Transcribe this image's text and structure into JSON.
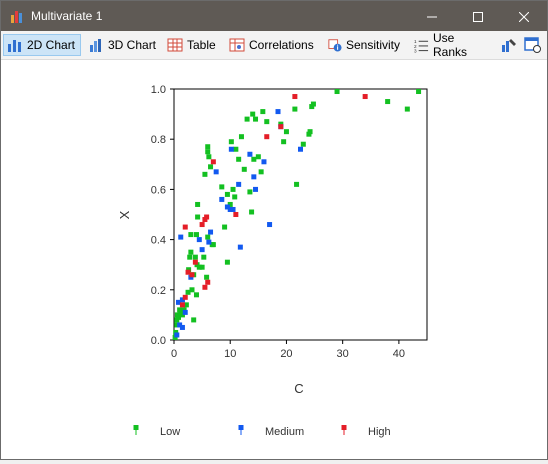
{
  "window": {
    "title": "Multivariate 1"
  },
  "toolbar": {
    "tabs": [
      {
        "label": "2D Chart",
        "icon": "bar-chart-icon",
        "active": true
      },
      {
        "label": "3D Chart",
        "icon": "3d-chart-icon",
        "active": false
      },
      {
        "label": "Table",
        "icon": "table-icon",
        "active": false
      },
      {
        "label": "Correlations",
        "icon": "correlations-icon",
        "active": false
      },
      {
        "label": "Sensitivity",
        "icon": "sensitivity-icon",
        "active": false
      },
      {
        "label": "Use Ranks",
        "icon": "ranks-icon",
        "active": false
      }
    ],
    "icons": [
      "chart-settings-icon",
      "window-options-icon"
    ]
  },
  "colors": {
    "Low": "#13c021",
    "Medium": "#1259f0",
    "High": "#e41e28"
  },
  "chart_data": {
    "type": "scatter",
    "xlabel": "C",
    "ylabel": "X",
    "xlim": [
      0,
      45
    ],
    "ylim": [
      0,
      1
    ],
    "xticks": [
      "0",
      "10",
      "20",
      "30",
      "40"
    ],
    "yticks": [
      "0.0",
      "0.2",
      "0.4",
      "0.6",
      "0.8",
      "1.0"
    ],
    "grid": false,
    "legend_position": "bottom",
    "series": [
      {
        "name": "Low",
        "points": [
          [
            0.2,
            0.01
          ],
          [
            0.3,
            0.03
          ],
          [
            0.5,
            0.06
          ],
          [
            0.5,
            0.08
          ],
          [
            0.6,
            0.1
          ],
          [
            0.8,
            0.09
          ],
          [
            1,
            0.12
          ],
          [
            1.2,
            0.11
          ],
          [
            1.5,
            0.1
          ],
          [
            1.8,
            0.12
          ],
          [
            2.2,
            0.14
          ],
          [
            2.5,
            0.19
          ],
          [
            2.6,
            0.28
          ],
          [
            2.8,
            0.33
          ],
          [
            3,
            0.35
          ],
          [
            3,
            0.42
          ],
          [
            3.2,
            0.2
          ],
          [
            3.5,
            0.26
          ],
          [
            3.5,
            0.08
          ],
          [
            3.8,
            0.33
          ],
          [
            4,
            0.42
          ],
          [
            4,
            0.18
          ],
          [
            4.1,
            0.3
          ],
          [
            4.2,
            0.49
          ],
          [
            4.2,
            0.54
          ],
          [
            4.5,
            0.29
          ],
          [
            5,
            0.29
          ],
          [
            5.3,
            0.33
          ],
          [
            5.5,
            0.66
          ],
          [
            5.8,
            0.25
          ],
          [
            6,
            0.75
          ],
          [
            6,
            0.77
          ],
          [
            6,
            0.41
          ],
          [
            6.2,
            0.73
          ],
          [
            6.5,
            0.69
          ],
          [
            6.8,
            0.38
          ],
          [
            7,
            0.38
          ],
          [
            8.5,
            0.61
          ],
          [
            9,
            0.45
          ],
          [
            9.5,
            0.58
          ],
          [
            9.5,
            0.31
          ],
          [
            10,
            0.54
          ],
          [
            10.2,
            0.79
          ],
          [
            10.5,
            0.6
          ],
          [
            10.8,
            0.57
          ],
          [
            11,
            0.76
          ],
          [
            11.5,
            0.72
          ],
          [
            12,
            0.81
          ],
          [
            12.5,
            0.68
          ],
          [
            13,
            0.88
          ],
          [
            13.5,
            0.59
          ],
          [
            13.8,
            0.51
          ],
          [
            14,
            0.9
          ],
          [
            14.2,
            0.72
          ],
          [
            14.5,
            0.88
          ],
          [
            15,
            0.73
          ],
          [
            15.5,
            0.67
          ],
          [
            15.8,
            0.91
          ],
          [
            16.5,
            0.87
          ],
          [
            19,
            0.86
          ],
          [
            19.5,
            0.79
          ],
          [
            20,
            0.83
          ],
          [
            21.5,
            0.92
          ],
          [
            21.8,
            0.62
          ],
          [
            23,
            0.78
          ],
          [
            24,
            0.82
          ],
          [
            24.2,
            0.83
          ],
          [
            24.5,
            0.93
          ],
          [
            24.8,
            0.94
          ],
          [
            29,
            0.99
          ],
          [
            38,
            0.95
          ],
          [
            41.5,
            0.92
          ],
          [
            43.5,
            0.99
          ]
        ]
      },
      {
        "name": "Medium",
        "points": [
          [
            0.5,
            0.02
          ],
          [
            0.8,
            0.15
          ],
          [
            1,
            0.06
          ],
          [
            1.2,
            0.41
          ],
          [
            1.5,
            0.05
          ],
          [
            1.5,
            0.16
          ],
          [
            2,
            0.11
          ],
          [
            3,
            0.25
          ],
          [
            4.5,
            0.4
          ],
          [
            5,
            0.36
          ],
          [
            6.2,
            0.39
          ],
          [
            6.5,
            0.43
          ],
          [
            7.5,
            0.67
          ],
          [
            8.5,
            0.56
          ],
          [
            9.5,
            0.53
          ],
          [
            10,
            0.52
          ],
          [
            10.2,
            0.76
          ],
          [
            10.5,
            0.52
          ],
          [
            11.5,
            0.62
          ],
          [
            11.8,
            0.37
          ],
          [
            13.5,
            0.74
          ],
          [
            14.2,
            0.65
          ],
          [
            14.5,
            0.6
          ],
          [
            16,
            0.71
          ],
          [
            17,
            0.46
          ],
          [
            18.5,
            0.91
          ],
          [
            19,
            0.85
          ],
          [
            22.5,
            0.76
          ]
        ]
      },
      {
        "name": "High",
        "points": [
          [
            1.5,
            0.14
          ],
          [
            2,
            0.17
          ],
          [
            2,
            0.45
          ],
          [
            2.5,
            0.27
          ],
          [
            3.2,
            0.26
          ],
          [
            3.8,
            0.31
          ],
          [
            5,
            0.46
          ],
          [
            5.5,
            0.21
          ],
          [
            5.5,
            0.48
          ],
          [
            5.8,
            0.49
          ],
          [
            6,
            0.23
          ],
          [
            7,
            0.71
          ],
          [
            11,
            0.5
          ],
          [
            16.5,
            0.81
          ],
          [
            19,
            0.85
          ],
          [
            21.5,
            0.97
          ],
          [
            34,
            0.97
          ]
        ]
      }
    ]
  }
}
